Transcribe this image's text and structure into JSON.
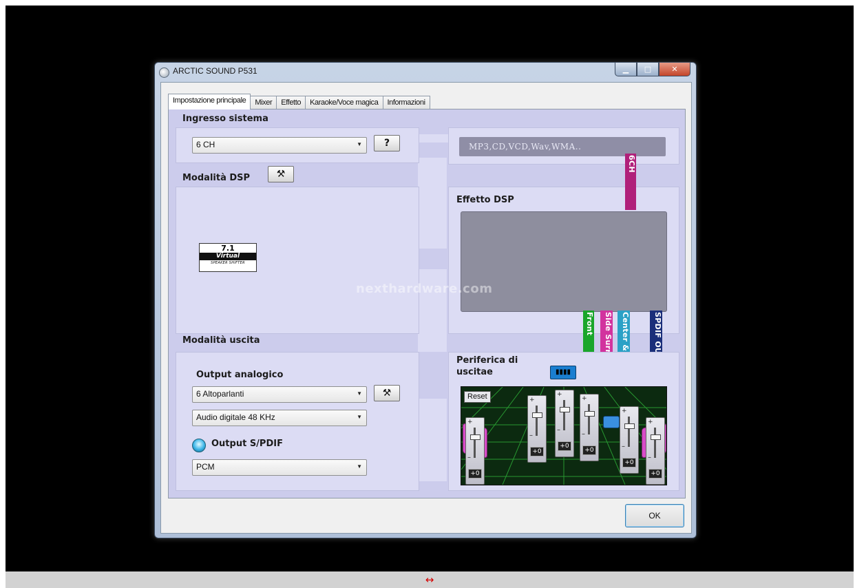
{
  "window": {
    "title": "ARCTIC SOUND P531"
  },
  "tabs": [
    "Impostazione principale",
    "Mixer",
    "Effetto",
    "Karaoke/Voce magica",
    "Informazioni"
  ],
  "input": {
    "heading": "Ingresso sistema",
    "selected": "6 CH",
    "help_label": "?",
    "source_info": "MP3,CD,VCD,Wav,WMA.."
  },
  "dsp": {
    "heading": "Modalità DSP",
    "logo": {
      "number": "7.1",
      "word": "Virtual",
      "tag": "SPEAKER SHIFTER"
    },
    "effect_heading": "Effetto DSP",
    "channel_6ch": "6CH"
  },
  "channels": {
    "front": "Front",
    "side_surround": "Side Surround",
    "center_sub": "Center & Sub",
    "spdif_out": "SPDIF OUT"
  },
  "output": {
    "heading": "Modalità uscita",
    "analog_heading": "Output analogico",
    "speakers_selected": "6 Altoparlanti",
    "digital_selected": "Audio digitale  48 KHz",
    "spdif_heading": "Output S/PDIF",
    "spdif_selected": "PCM"
  },
  "peripheral": {
    "heading": "Periferica di uscitae",
    "reset_label": "Reset",
    "fader_values": [
      "+0",
      "+0",
      "+0",
      "+0",
      "+0",
      "+0"
    ]
  },
  "watermark": "nexthardware.com",
  "ok_label": "OK",
  "bottom_bar": {
    "symbol": "↔"
  },
  "colors": {
    "panel": "#ccccec",
    "front": "#1aa62b",
    "side_surround": "#d2329e",
    "center_sub": "#2ba1c6",
    "spdif_out": "#1b2f7a",
    "channel_6ch": "#b0207a"
  }
}
